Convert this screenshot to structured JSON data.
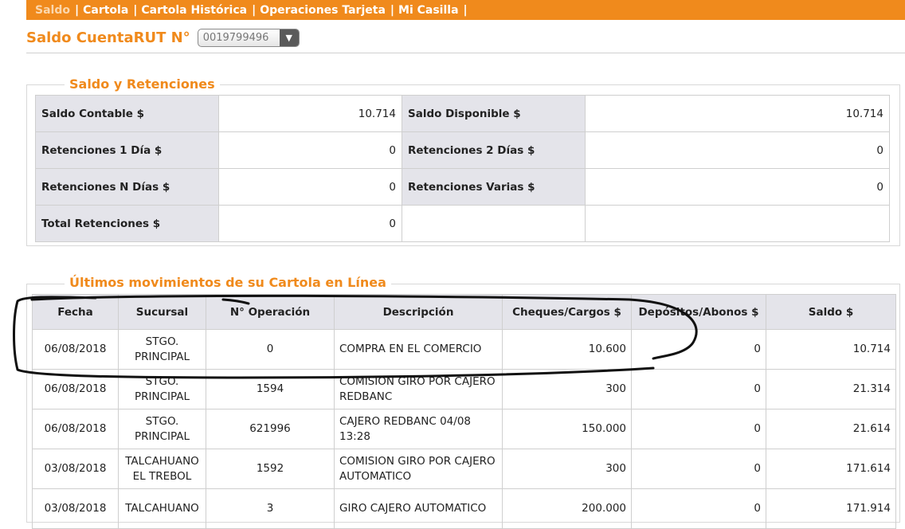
{
  "nav": {
    "items": [
      {
        "label": "Saldo",
        "active": true
      },
      {
        "label": "Cartola",
        "active": false
      },
      {
        "label": "Cartola Histórica",
        "active": false
      },
      {
        "label": "Operaciones Tarjeta",
        "active": false
      },
      {
        "label": "Mi Casilla",
        "active": false
      }
    ],
    "separator": "|"
  },
  "header": {
    "title": "Saldo CuentaRUT N°",
    "account_number": "0019799496",
    "dropdown_icon": "chevron-down-icon"
  },
  "saldo": {
    "legend": "Saldo y Retenciones",
    "rows": [
      {
        "l1": "Saldo Contable $",
        "v1": "10.714",
        "l2": "Saldo Disponible $",
        "v2": "10.714"
      },
      {
        "l1": "Retenciones 1 Día $",
        "v1": "0",
        "l2": "Retenciones 2 Días $",
        "v2": "0"
      },
      {
        "l1": "Retenciones N Días $",
        "v1": "0",
        "l2": "Retenciones Varias $",
        "v2": "0"
      },
      {
        "l1": "Total Retenciones $",
        "v1": "0",
        "l2": "",
        "v2": ""
      }
    ]
  },
  "movimientos": {
    "legend": "Últimos movimientos de su Cartola en Línea",
    "headers": [
      "Fecha",
      "Sucursal",
      "N° Operación",
      "Descripción",
      "Cheques/Cargos $",
      "Depósitos/Abonos $",
      "Saldo $"
    ],
    "rows": [
      {
        "fecha": "06/08/2018",
        "sucursal": "STGO. PRINCIPAL",
        "operacion": "0",
        "descripcion": "COMPRA EN EL COMERCIO",
        "cargos": "10.600",
        "abonos": "0",
        "saldo": "10.714"
      },
      {
        "fecha": "06/08/2018",
        "sucursal": "STGO. PRINCIPAL",
        "operacion": "1594",
        "descripcion": "COMISION GIRO POR CAJERO REDBANC",
        "cargos": "300",
        "abonos": "0",
        "saldo": "21.314"
      },
      {
        "fecha": "06/08/2018",
        "sucursal": "STGO. PRINCIPAL",
        "operacion": "621996",
        "descripcion": "CAJERO REDBANC 04/08 13:28",
        "cargos": "150.000",
        "abonos": "0",
        "saldo": "21.614"
      },
      {
        "fecha": "03/08/2018",
        "sucursal": "TALCAHUANO EL TREBOL",
        "operacion": "1592",
        "descripcion": "COMISION GIRO POR CAJERO AUTOMATICO",
        "cargos": "300",
        "abonos": "0",
        "saldo": "171.614"
      },
      {
        "fecha": "03/08/2018",
        "sucursal": "TALCAHUANO",
        "operacion": "3",
        "descripcion": "GIRO CAJERO AUTOMATICO",
        "cargos": "200.000",
        "abonos": "0",
        "saldo": "171.914"
      }
    ]
  },
  "colors": {
    "accent": "#f08a1c",
    "label_bg": "#e4e4ea",
    "border": "#cfcfcf"
  }
}
